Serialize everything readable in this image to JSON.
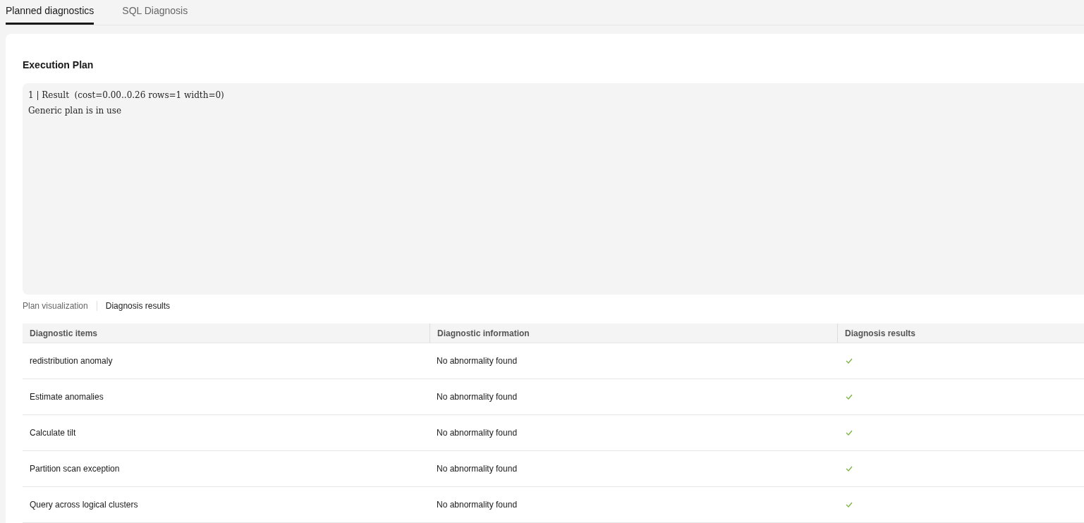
{
  "tabs": [
    {
      "label": "Planned diagnostics",
      "selected": true
    },
    {
      "label": "SQL Diagnosis",
      "selected": false
    }
  ],
  "execution_plan": {
    "title": "Execution Plan",
    "lines": [
      "1 | Result  (cost=0.00..0.26 rows=1 width=0)",
      "Generic plan is in use"
    ]
  },
  "sub_tabs": [
    {
      "label": "Plan visualization",
      "selected": false
    },
    {
      "label": "Diagnosis results",
      "selected": true
    }
  ],
  "table": {
    "columns": [
      "Diagnostic items",
      "Diagnostic information",
      "Diagnosis results"
    ],
    "rows": [
      {
        "item": "redistribution anomaly",
        "information": "No abnormality found",
        "passed": true
      },
      {
        "item": "Estimate anomalies",
        "information": "No abnormality found",
        "passed": true
      },
      {
        "item": "Calculate tilt",
        "information": "No abnormality found",
        "passed": true
      },
      {
        "item": "Partition scan exception",
        "information": "No abnormality found",
        "passed": true
      },
      {
        "item": "Query across logical clusters",
        "information": "No abnormality found",
        "passed": true
      }
    ]
  }
}
